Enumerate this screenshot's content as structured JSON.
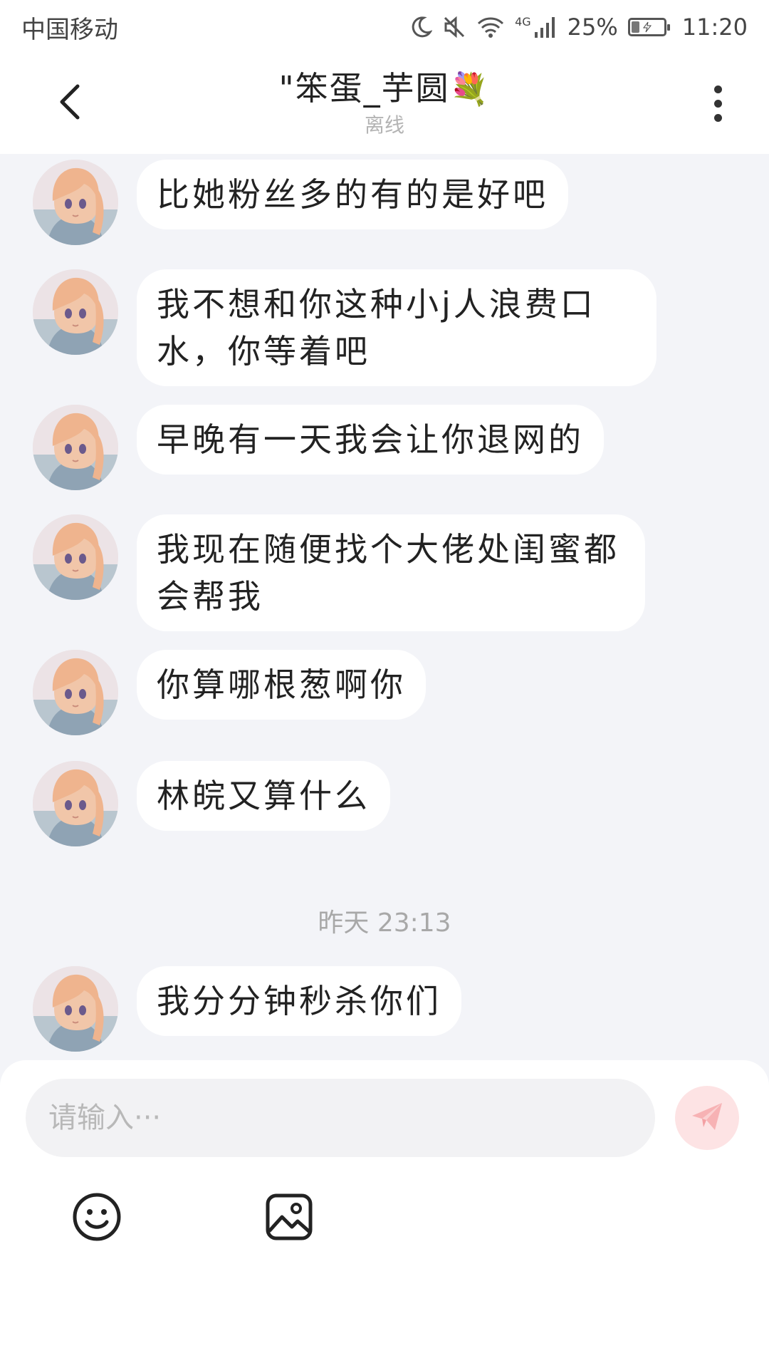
{
  "status_bar": {
    "carrier": "中国移动",
    "network": "4G",
    "battery_text": "25%",
    "battery_level": 0.25,
    "time": "11:20",
    "icons": [
      "moon-icon",
      "mute-icon",
      "wifi-icon",
      "signal-icon",
      "battery-icon"
    ]
  },
  "header": {
    "title": "\"笨蛋_芋圆",
    "title_emoji": "💐",
    "subtitle": "离线",
    "icons": [
      "back-icon",
      "more-icon"
    ]
  },
  "messages": [
    {
      "text": "比她粉丝多的有的是好吧"
    },
    {
      "text": "我不想和你这种小j人浪费口水，你等着吧"
    },
    {
      "text": "早晚有一天我会让你退网的"
    },
    {
      "text": "我现在随便找个大佬处闺蜜都会帮我"
    },
    {
      "text": "你算哪根葱啊你"
    },
    {
      "text": "林皖又算什么"
    },
    {
      "text": "我分分钟秒杀你们"
    }
  ],
  "timestamp": "昨天 23:13",
  "composer": {
    "placeholder": "请输入···",
    "value": "",
    "icons": [
      "send-icon",
      "emoji-icon",
      "image-icon"
    ]
  },
  "colors": {
    "background": "#f3f4f8",
    "bubble": "#ffffff",
    "send_button": "#fde3e4",
    "send_icon": "#f7b2b4"
  }
}
